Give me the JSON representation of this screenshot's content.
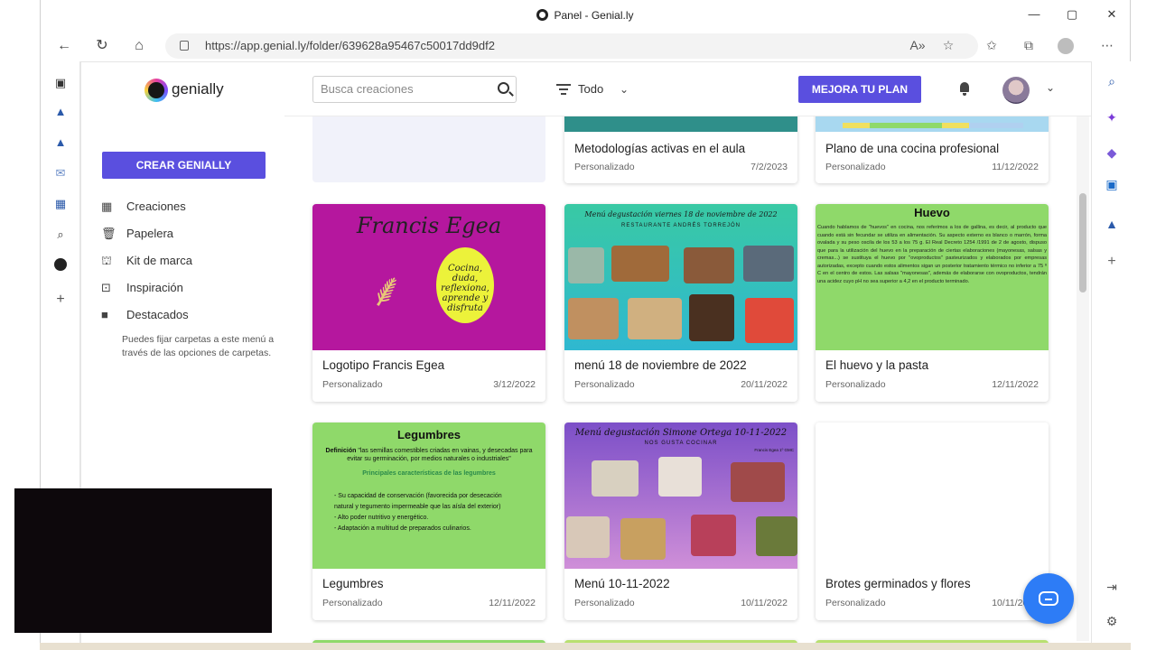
{
  "window": {
    "title": "Panel - Genial.ly",
    "minimize": "—",
    "maximize": "▢",
    "close": "✕"
  },
  "browser": {
    "url": "https://app.genial.ly/folder/639628a95467c50017dd9df2"
  },
  "app": {
    "logo_text": "genially",
    "create_button": "CREAR GENIALLY",
    "nav": [
      {
        "label": "Creaciones",
        "icon": "grid-icon"
      },
      {
        "label": "Papelera",
        "icon": "trash-icon"
      },
      {
        "label": "Kit de marca",
        "icon": "brand-kit-icon"
      },
      {
        "label": "Inspiración",
        "icon": "inspiration-icon"
      },
      {
        "label": "Destacados",
        "icon": "folder-icon"
      }
    ],
    "sidebar_note": "Puedes fijar carpetas a este menú a través de las opciones de carpetas.",
    "search_placeholder": "Busca creaciones",
    "filter_label": "Todo",
    "upgrade_button": "MEJORA TU PLAN"
  },
  "cards": [
    {
      "name": "Metodologías activas en el aula",
      "type": "Personalizado",
      "date": "7/2/2023"
    },
    {
      "name": "Plano de una cocina profesional",
      "type": "Personalizado",
      "date": "11/12/2022"
    },
    {
      "name": "Logotipo Francis Egea",
      "type": "Personalizado",
      "date": "3/12/2022",
      "thumb_title": "Francis Egea",
      "thumb_text": "Cocina, duda, reflexiona, aprende y disfruta"
    },
    {
      "name": "menú 18 de noviembre de 2022",
      "type": "Personalizado",
      "date": "20/11/2022",
      "thumb_title": "Menú degustación viernes 18 de noviembre de 2022",
      "thumb_sub": "RESTAURANTE ANDRÉS TORREJÓN"
    },
    {
      "name": "El huevo y la pasta",
      "type": "Personalizado",
      "date": "12/11/2022",
      "thumb_title": "Huevo",
      "thumb_text": "Cuando hablamos de \"huevos\" en cocina, nos referimos a los de gallina, es decir, al producto que cuando está sin fecundar se utiliza en alimentación. Su aspecto externo es blanco o marrón, forma ovalada y su peso oscila de los 53 a los 75 g. El Real Decreto 1254 /1991 de 2 de agosto, dispuso que para la utilización del huevo en la preparación de ciertas elaboraciones (mayonesas, salsas y cremas...) se sustituya el huevo por \"ovoproductos\" pasteurizados y elaborados por empresas autorizadas, excepto cuando estos alimentos sigan un posterior tratamiento térmico no inferior a 75 º C en el centro de estos. Las salsas \"mayonesas\", además de elaborarse con ovoproductos, tendrán una acidez cuyo pH no sea superior a 4,2 en el producto terminado."
    },
    {
      "name": "Legumbres",
      "type": "Personalizado",
      "date": "12/11/2022",
      "thumb_title": "Legumbres",
      "thumb_def_label": "Definición",
      "thumb_def": "\"las semillas comestibles criadas en vainas, y desecadas para evitar su germinación, por medios naturales o industriales\"",
      "thumb_sub": "Principales características de las legumbres",
      "thumb_b1": "- Su capacidad de conservación (favorecida por desecación natural y tegumento impermeable que las aísla del exterior)",
      "thumb_b2": "- Alto poder nutritivo y energético.",
      "thumb_b3": "- Adaptación a multitud de preparados culinarios."
    },
    {
      "name": "Menú 10-11-2022",
      "type": "Personalizado",
      "date": "10/11/2022",
      "thumb_title": "Menú degustación Simone Ortega 10-11-2022",
      "thumb_sub": "NOS GUSTA COCINAR",
      "thumb_author": "Francis Egea 1º GMC"
    },
    {
      "name": "Brotes germinados y flores",
      "type": "Personalizado",
      "date": "10/11/2022"
    }
  ],
  "colors": {
    "accent": "#5a4fdf",
    "chat": "#2d7cf6",
    "thumb_magenta": "#b5179e",
    "thumb_green": "#8fd96a",
    "thumb_teal": "#2fb8a8"
  }
}
